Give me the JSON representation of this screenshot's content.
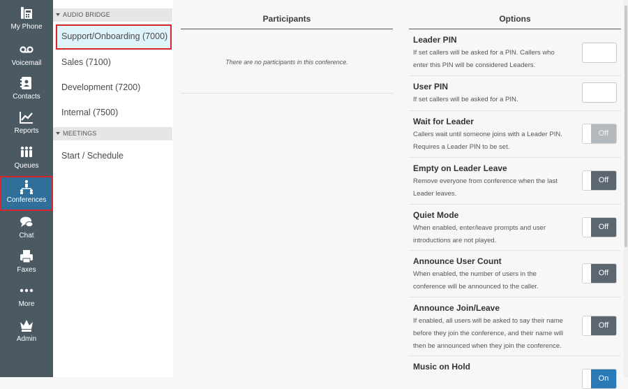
{
  "nav": {
    "items": [
      {
        "label": "My Phone",
        "icon": "phone-icon"
      },
      {
        "label": "Voicemail",
        "icon": "voicemail-icon"
      },
      {
        "label": "Contacts",
        "icon": "contacts-icon"
      },
      {
        "label": "Reports",
        "icon": "reports-icon"
      },
      {
        "label": "Queues",
        "icon": "queues-icon"
      },
      {
        "label": "Conferences",
        "icon": "conferences-icon"
      },
      {
        "label": "Chat",
        "icon": "chat-icon"
      },
      {
        "label": "Faxes",
        "icon": "fax-icon"
      },
      {
        "label": "More",
        "icon": "more-icon"
      },
      {
        "label": "Admin",
        "icon": "crown-icon"
      }
    ],
    "active": "Conferences"
  },
  "list": {
    "audio_bridge_header": "AUDIO BRIDGE",
    "audio_bridge_items": [
      "Support/Onboarding (7000)",
      "Sales (7100)",
      "Development (7200)",
      "Internal (7500)"
    ],
    "meetings_header": "MEETINGS",
    "meetings_items": [
      "Start / Schedule"
    ]
  },
  "participants": {
    "title": "Participants",
    "empty_message": "There are no participants in this conference."
  },
  "options": {
    "title": "Options",
    "toggle_off_label": "Off",
    "toggle_on_label": "On",
    "items": [
      {
        "name": "Leader PIN",
        "desc": "If set callers will be asked for a PIN. Callers who enter this PIN will be considered Leaders.",
        "control": "input",
        "value": ""
      },
      {
        "name": "User PIN",
        "desc": "If set callers will be asked for a PIN.",
        "control": "input",
        "value": ""
      },
      {
        "name": "Wait for Leader",
        "desc": "Callers wait until someone joins with a Leader PIN. Requires a Leader PIN to be set.",
        "control": "toggle",
        "state": "off",
        "disabled": true
      },
      {
        "name": "Empty on Leader Leave",
        "desc": "Remove everyone from conference when the last Leader leaves.",
        "control": "toggle",
        "state": "off"
      },
      {
        "name": "Quiet Mode",
        "desc": "When enabled, enter/leave prompts and user introductions are not played.",
        "control": "toggle",
        "state": "off"
      },
      {
        "name": "Announce User Count",
        "desc": "When enabled, the number of users in the conference will be announced to the caller.",
        "control": "toggle",
        "state": "off"
      },
      {
        "name": "Announce Join/Leave",
        "desc": "If enabled, all users will be asked to say their name before they join the conference, and their name will then be announced when they join the conference.",
        "control": "toggle",
        "state": "off"
      },
      {
        "name": "Music on Hold",
        "desc": "",
        "control": "toggle",
        "state": "on"
      }
    ]
  },
  "colors": {
    "nav_bg": "#4b5963",
    "nav_active": "#2f6f9a",
    "highlight_outline": "#d9262c",
    "selected_item_bg": "#dff3fb",
    "toggle_off": "#5b6670",
    "toggle_on": "#2a7ab8"
  }
}
